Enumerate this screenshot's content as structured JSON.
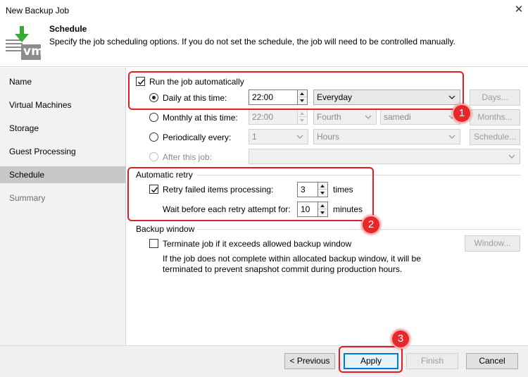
{
  "window": {
    "title": "New Backup Job"
  },
  "header": {
    "title": "Schedule",
    "description": "Specify the job scheduling options. If you do not set the schedule, the job will need to be controlled manually.",
    "logo_text": "vm"
  },
  "sidebar": {
    "items": [
      {
        "label": "Name",
        "state": "normal"
      },
      {
        "label": "Virtual Machines",
        "state": "normal"
      },
      {
        "label": "Storage",
        "state": "normal"
      },
      {
        "label": "Guest Processing",
        "state": "normal"
      },
      {
        "label": "Schedule",
        "state": "active"
      },
      {
        "label": "Summary",
        "state": "disabled"
      }
    ]
  },
  "schedule": {
    "run_auto_label": "Run the job automatically",
    "run_auto_checked": true,
    "daily_label": "Daily at this time:",
    "daily_time": "22:00",
    "daily_days": "Everyday",
    "days_button": "Days...",
    "monthly_label": "Monthly at this time:",
    "monthly_time": "22:00",
    "monthly_week": "Fourth",
    "monthly_day": "samedi",
    "months_button": "Months...",
    "periodic_label": "Periodically every:",
    "periodic_value": "1",
    "periodic_unit": "Hours",
    "schedule_button": "Schedule...",
    "after_label": "After this job:",
    "after_value": ""
  },
  "retry": {
    "group_title": "Automatic retry",
    "retry_label": "Retry failed items processing:",
    "retry_checked": true,
    "retry_value": "3",
    "retry_unit": "times",
    "wait_label": "Wait before each retry attempt for:",
    "wait_value": "10",
    "wait_unit": "minutes"
  },
  "backup_window": {
    "group_title": "Backup window",
    "terminate_label": "Terminate job if it exceeds allowed backup window",
    "terminate_checked": false,
    "window_button": "Window...",
    "note_line1": "If the job does not complete within allocated backup window, it will be",
    "note_line2": "terminated to prevent snapshot commit during production hours."
  },
  "footer": {
    "previous": "< Previous",
    "apply": "Apply",
    "finish": "Finish",
    "cancel": "Cancel"
  },
  "annotations": {
    "badge1": "1",
    "badge2": "2",
    "badge3": "3"
  },
  "colors": {
    "callout": "#e31c23",
    "logo_green": "#3aa935",
    "logo_gray": "#8c8c8c",
    "selected_nav": "#c8c8c8"
  }
}
